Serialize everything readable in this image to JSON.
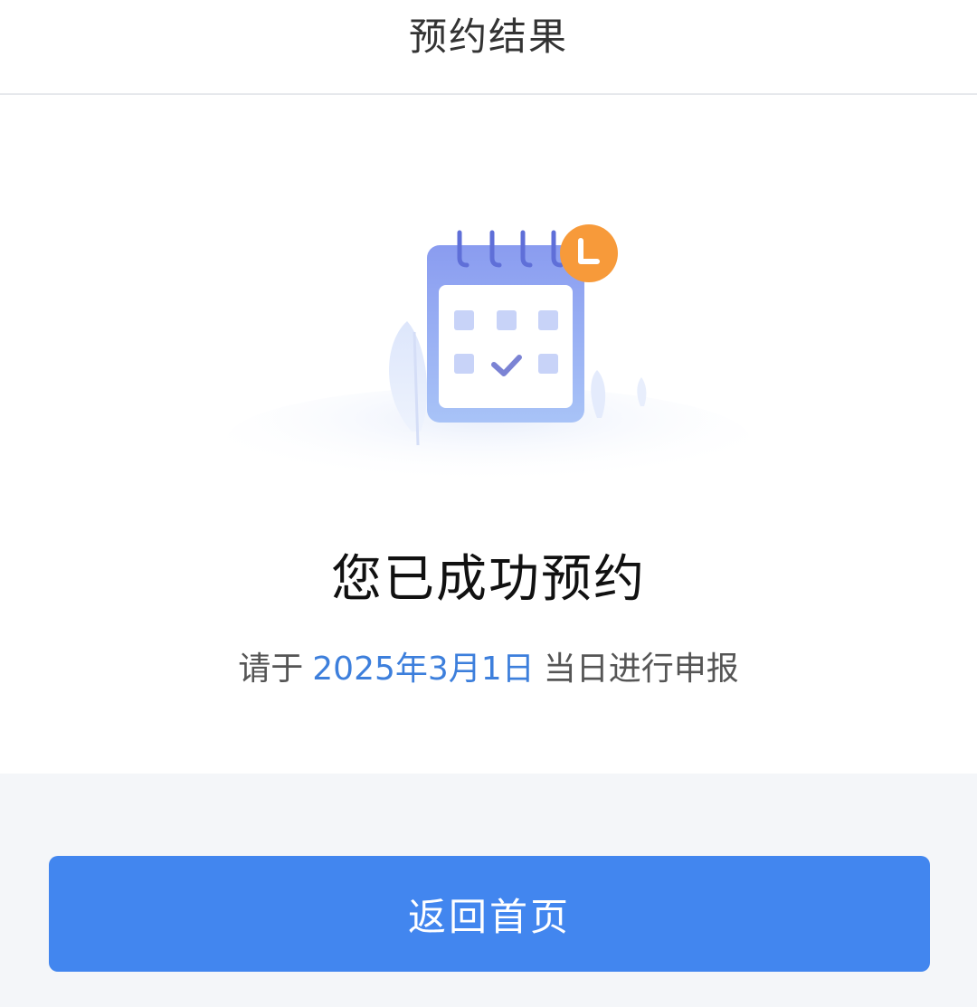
{
  "header": {
    "title": "预约结果"
  },
  "result": {
    "title": "您已成功预约",
    "desc_prefix": "请于",
    "date": "2025年3月1日",
    "desc_suffix": "当日进行申报"
  },
  "footer": {
    "home_button_label": "返回首页"
  },
  "colors": {
    "accent": "#4286ef",
    "date_text": "#3d7fdc",
    "footer_bg": "#f4f6f9",
    "clock_badge": "#f79a3a"
  },
  "icons": [
    "calendar-check-icon",
    "clock-icon"
  ]
}
